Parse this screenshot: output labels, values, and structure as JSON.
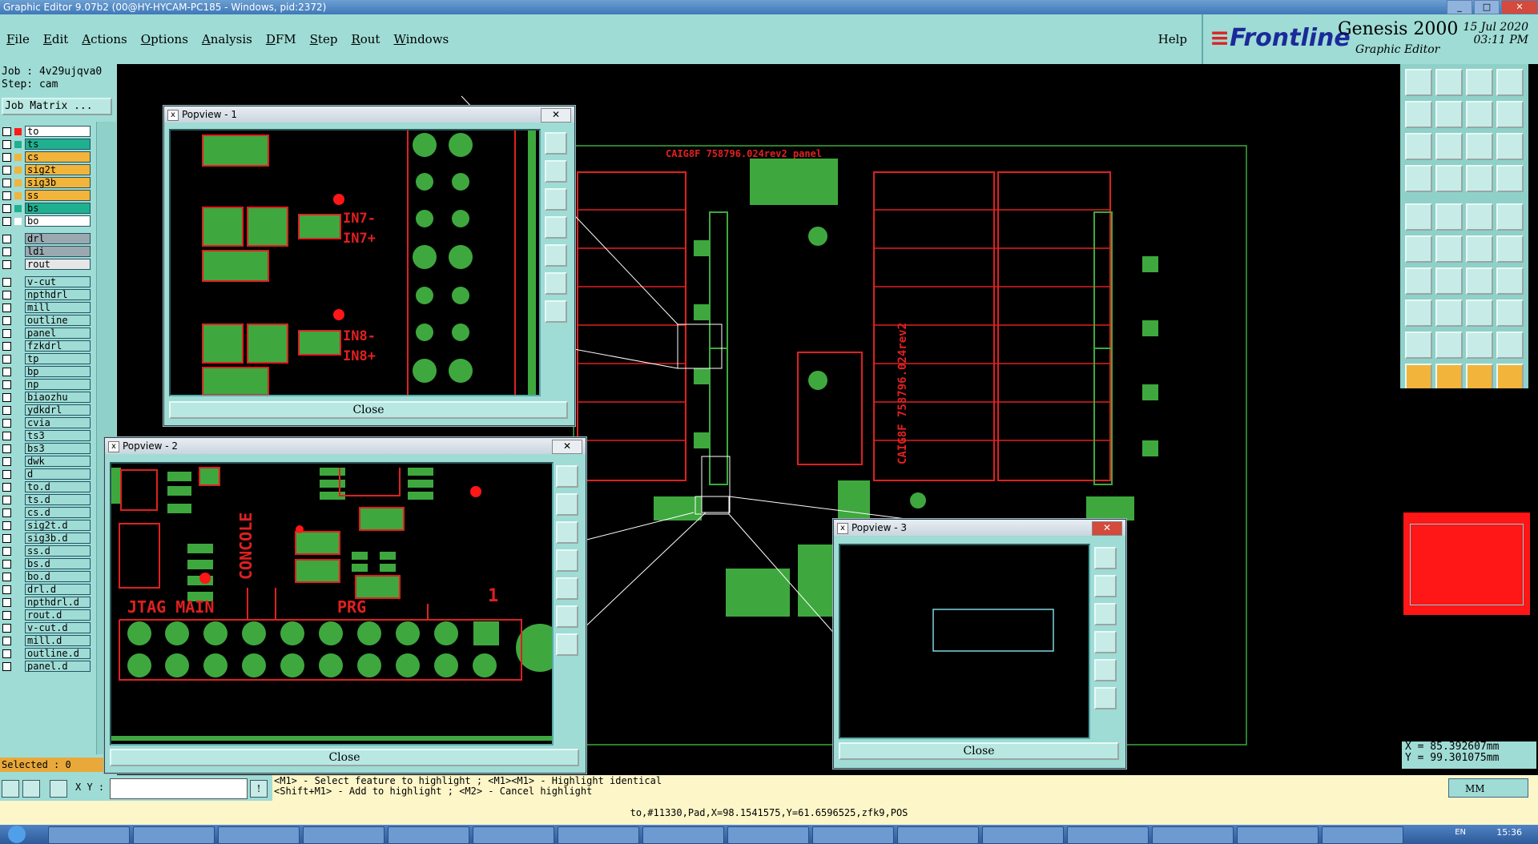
{
  "window": {
    "title": "Graphic Editor 9.07b2 (00@HY-HYCAM-PC185 - Windows, pid:2372)",
    "min_label": "_",
    "max_label": "□",
    "close_label": "✕"
  },
  "menu": {
    "items": [
      "File",
      "Edit",
      "Actions",
      "Options",
      "Analysis",
      "DFM",
      "Step",
      "Rout",
      "Windows"
    ],
    "help": "Help"
  },
  "brand": {
    "logo_prefix": "Frontline",
    "product": "Genesis 2000",
    "subtitle": "Graphic Editor",
    "date": "15 Jul 2020",
    "time": "03:11 PM"
  },
  "job": {
    "job_line": "Job : 4v29ujqva0",
    "step_line": "Step: cam",
    "matrix_button": "Job Matrix ..."
  },
  "layers": {
    "group1": [
      {
        "name": "to",
        "color": "#ff1a1a",
        "bg": "#ffffff"
      },
      {
        "name": "ts",
        "color": "#1fb08f",
        "bg": "#1fb08f"
      },
      {
        "name": "cs",
        "color": "#f2b43a",
        "bg": "#f2b43a"
      },
      {
        "name": "sig2t",
        "color": "#f2b43a",
        "bg": "#f2b43a"
      },
      {
        "name": "sig3b",
        "color": "#f2b43a",
        "bg": "#f2b43a"
      },
      {
        "name": "ss",
        "color": "#f2b43a",
        "bg": "#f2b43a"
      },
      {
        "name": "bs",
        "color": "#1fb08f",
        "bg": "#1fb08f"
      },
      {
        "name": "bo",
        "color": "#ffffff",
        "bg": "#ffffff"
      }
    ],
    "group2": [
      {
        "name": "drl",
        "color": "#9aa9b0",
        "bg": "#9aa9b0"
      },
      {
        "name": "ldi",
        "color": "#9aa9b0",
        "bg": "#9aa9b0"
      },
      {
        "name": "rout",
        "color": "#e6e6e6",
        "bg": "#e6e6e6"
      }
    ],
    "group3": [
      "v-cut",
      "npthdrl",
      "mill",
      "outline",
      "panel",
      "fzkdrl",
      "tp",
      "bp",
      "np",
      "biaozhu",
      "ydkdrl",
      "cvia",
      "ts3",
      "bs3",
      "dwk",
      "d",
      "to.d",
      "ts.d",
      "cs.d",
      "sig2t.d",
      "sig3b.d",
      "ss.d",
      "bs.d",
      "bo.d",
      "drl.d",
      "npthdrl.d",
      "rout.d",
      "v-cut.d",
      "mill.d",
      "outline.d",
      "panel.d"
    ]
  },
  "selected": "Selected : 0",
  "board": {
    "panel_label": "CAIG8F  758796.024rev2  panel",
    "vertical_label": "CAIG8F 758796.024rev2"
  },
  "popviews": [
    {
      "title": "Popview - 1",
      "close": "Close",
      "labels": [
        "IN7-",
        "IN7+",
        "IN8-",
        "IN8+"
      ]
    },
    {
      "title": "Popview - 2",
      "close": "Close",
      "labels": [
        "CONCOLE",
        "JTAG MAIN",
        "PRG",
        "1"
      ]
    },
    {
      "title": "Popview - 3",
      "close": "Close",
      "labels": []
    }
  ],
  "coords": {
    "x": "X = 85.392607mm",
    "y": "Y = 99.301075mm"
  },
  "status": {
    "xy_label": "X Y :",
    "hint1": "<M1> - Select feature to highlight ; <M1><M1> - Highlight identical",
    "hint2": "<Shift+M1> - Add to highlight ; <M2> - Cancel highlight",
    "units": "MM",
    "info": "to,#11330,Pad,X=98.1541575,Y=61.6596525,zfk9,POS"
  },
  "taskbar": {
    "clock": "15:36",
    "lang": "EN"
  }
}
